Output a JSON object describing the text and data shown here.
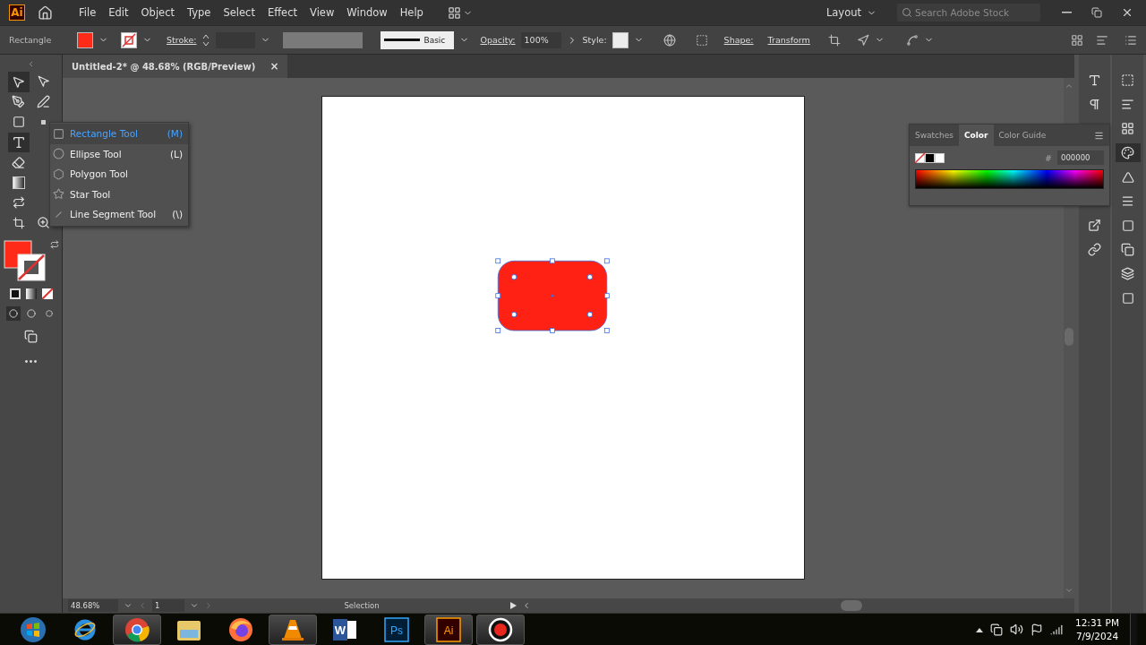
{
  "menu_bar": {
    "logo": "Ai",
    "items": [
      "File",
      "Edit",
      "Object",
      "Type",
      "Select",
      "Effect",
      "View",
      "Window",
      "Help"
    ],
    "workspace": "Layout",
    "search": {
      "placeholder": "Search Adobe Stock"
    }
  },
  "control_bar": {
    "tool_name": "Rectangle",
    "stroke_label": "Stroke:",
    "stroke_style": "Basic",
    "opacity_label": "Opacity:",
    "opacity_value": "100%",
    "style_label": "Style:",
    "shape_label": "Shape:",
    "transform_label": "Transform"
  },
  "document_tab": {
    "title": "Untitled-2* @ 48.68% (RGB/Preview)",
    "close": "×"
  },
  "tool_flyout": {
    "items": [
      {
        "kind": "rectangle",
        "label": "Rectangle Tool",
        "shortcut": "(M)",
        "selected": true
      },
      {
        "kind": "ellipse",
        "label": "Ellipse Tool",
        "shortcut": "(L)",
        "selected": false
      },
      {
        "kind": "polygon",
        "label": "Polygon Tool",
        "selected": false
      },
      {
        "kind": "star",
        "label": "Star Tool",
        "selected": false
      },
      {
        "kind": "line",
        "label": "Line Segment Tool",
        "shortcut": "(\\)",
        "selected": false
      }
    ]
  },
  "color_panel": {
    "tabs": [
      {
        "label": "Swatches",
        "selected": false
      },
      {
        "label": "Color",
        "selected": true
      },
      {
        "label": "Color Guide",
        "selected": false
      }
    ],
    "hex_label": "#",
    "hex_value": "000000"
  },
  "status_bar": {
    "zoom": "48.68%",
    "artboard": "1",
    "tool": "Selection"
  },
  "taskbar": {
    "apps": [
      {
        "kind": "start",
        "running": false
      },
      {
        "kind": "ie",
        "running": false
      },
      {
        "kind": "chrome",
        "running": true
      },
      {
        "kind": "folder",
        "running": false
      },
      {
        "kind": "firefox",
        "running": false
      },
      {
        "kind": "vlc",
        "running": true
      },
      {
        "kind": "word",
        "label": "W",
        "running": false
      },
      {
        "kind": "photoshop",
        "label": "Ps",
        "running": false
      },
      {
        "kind": "illustrator",
        "label": "Ai",
        "running": true
      },
      {
        "kind": "recorder",
        "running": true
      }
    ],
    "time": "12:31 PM",
    "date": "7/9/2024"
  }
}
